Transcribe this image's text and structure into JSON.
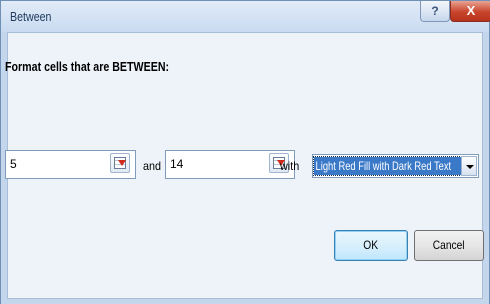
{
  "dialog": {
    "title": "Between",
    "help_label": "?",
    "close_label": "X"
  },
  "form": {
    "heading": "Format cells that are BETWEEN:",
    "value_from": "5",
    "and_label": "and",
    "value_to": "14",
    "with_label": "with",
    "format_selected": "Light Red Fill with Dark Red Text"
  },
  "buttons": {
    "ok": "OK",
    "cancel": "Cancel"
  }
}
